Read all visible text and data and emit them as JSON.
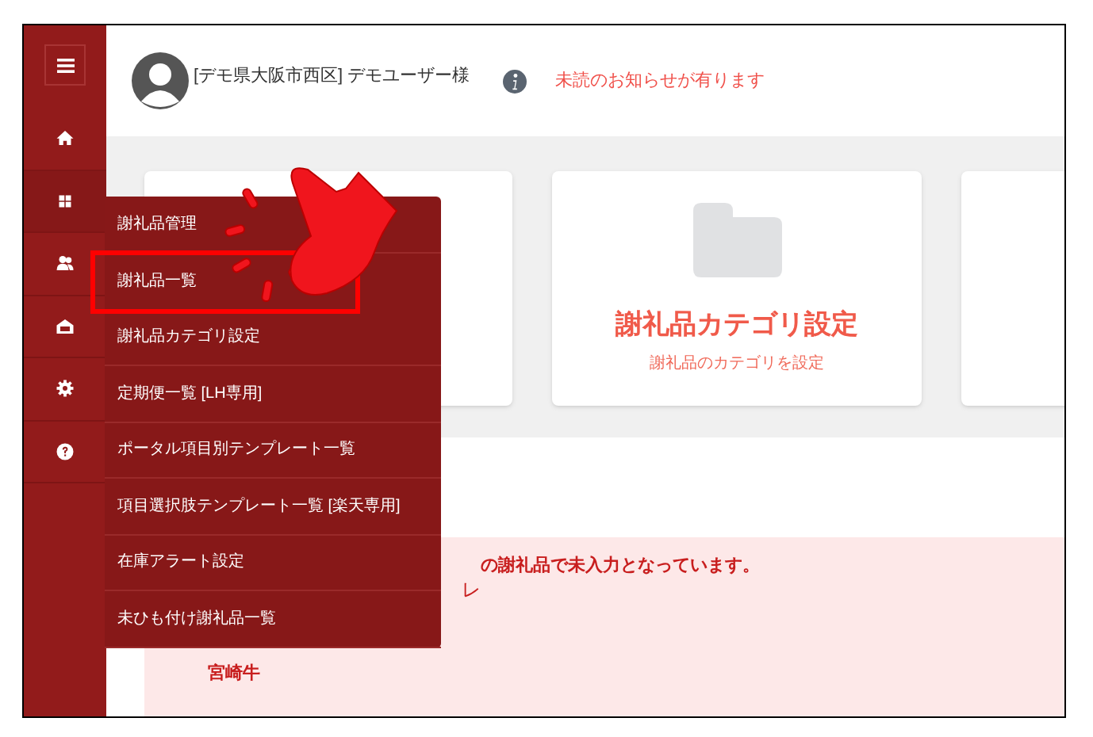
{
  "header": {
    "user": "[デモ県大阪市西区] デモユーザー様",
    "notice": "未読のお知らせが有ります"
  },
  "sidebar": {
    "items": [
      {
        "kind": "home",
        "selected": false
      },
      {
        "kind": "grid",
        "selected": true
      },
      {
        "kind": "users",
        "selected": false
      },
      {
        "kind": "house",
        "selected": false
      },
      {
        "kind": "gear",
        "selected": false
      },
      {
        "kind": "help",
        "selected": false
      }
    ]
  },
  "menu": {
    "title": "謝礼品管理",
    "items": [
      {
        "label": "謝礼品一覧",
        "highlighted": true
      },
      {
        "label": "謝礼品カテゴリ設定",
        "highlighted": false
      },
      {
        "label": "定期便一覧 [LH専用]",
        "highlighted": false
      },
      {
        "label": "ポータル項目別テンプレート一覧",
        "highlighted": false
      },
      {
        "label": "項目選択肢テンプレート一覧 [楽天専用]",
        "highlighted": false
      },
      {
        "label": "在庫アラート設定",
        "highlighted": false
      },
      {
        "label": "未ひも付け謝礼品一覧",
        "highlighted": false
      }
    ]
  },
  "cards": [
    {
      "title": "謝礼品カテゴリ設定",
      "subtitle": "謝礼品のカテゴリを設定"
    }
  ],
  "alert": {
    "message": "の謝礼品で未入力となっています。",
    "line_2": "レ",
    "item": "宮崎牛"
  }
}
